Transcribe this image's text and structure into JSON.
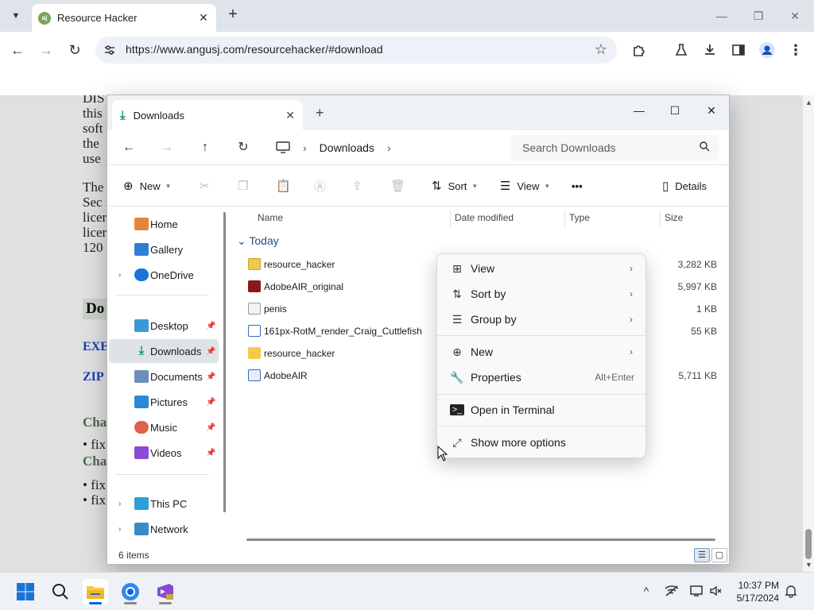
{
  "browser": {
    "tab_title": "Resource Hacker",
    "tab_favicon_text": "aj",
    "url": "https://www.angusj.com/resourcehacker/#download",
    "icons": [
      "back-icon",
      "forward-icon",
      "reload-icon",
      "site-info-icon",
      "star-icon",
      "extensions-icon",
      "labs-icon",
      "download-icon",
      "sidepanel-icon",
      "profile-icon",
      "menu-icon"
    ]
  },
  "page": {
    "lines_top": [
      "DIS",
      "this",
      "soft",
      "the",
      "use"
    ],
    "lines_mid": [
      "The",
      "Sec",
      "licer",
      "licer",
      "120"
    ],
    "heading": "Do",
    "link1": "EXE",
    "link2": "ZIP",
    "green1": "Cha",
    "bullet1": "fix",
    "green2": "Cha",
    "bullet2": "fix",
    "bullet3": "fix"
  },
  "explorer": {
    "tab_title": "Downloads",
    "breadcrumb": "Downloads",
    "search_placeholder": "Search Downloads",
    "commands": {
      "new": "New",
      "sort": "Sort",
      "view": "View",
      "more": "•••",
      "details": "Details"
    },
    "sidebar": {
      "home": "Home",
      "gallery": "Gallery",
      "onedrive": "OneDrive",
      "desktop": "Desktop",
      "downloads": "Downloads",
      "documents": "Documents",
      "pictures": "Pictures",
      "music": "Music",
      "videos": "Videos",
      "thispc": "This PC",
      "network": "Network"
    },
    "columns": {
      "name": "Name",
      "date": "Date modified",
      "type": "Type",
      "size": "Size"
    },
    "group": "Today",
    "files": [
      {
        "name": "resource_hacker",
        "size": "3,282 KB",
        "icon": "zip-folder-icon"
      },
      {
        "name": "AdobeAIR_original",
        "size": "5,997 KB",
        "icon": "adobe-air-icon"
      },
      {
        "name": "penis",
        "size": "1 KB",
        "icon": "image-file-icon"
      },
      {
        "name": "161px-RotM_render_Craig_Cuttlefish",
        "size": "55 KB",
        "icon": "image-file-icon"
      },
      {
        "name": "resource_hacker",
        "size": "",
        "icon": "folder-icon"
      },
      {
        "name": "AdobeAIR",
        "size": "5,711 KB",
        "icon": "app-icon"
      }
    ],
    "status": "6 items"
  },
  "context_menu": {
    "view": "View",
    "sort_by": "Sort by",
    "group_by": "Group by",
    "new": "New",
    "properties": "Properties",
    "properties_shortcut": "Alt+Enter",
    "terminal": "Open in Terminal",
    "more_options": "Show more options"
  },
  "taskbar": {
    "time": "10:37 PM",
    "date": "5/17/2024"
  },
  "colors": {
    "accent": "#0a5fd8",
    "downloads_green": "#1a9a5a",
    "group_header": "#2b4b8c"
  }
}
